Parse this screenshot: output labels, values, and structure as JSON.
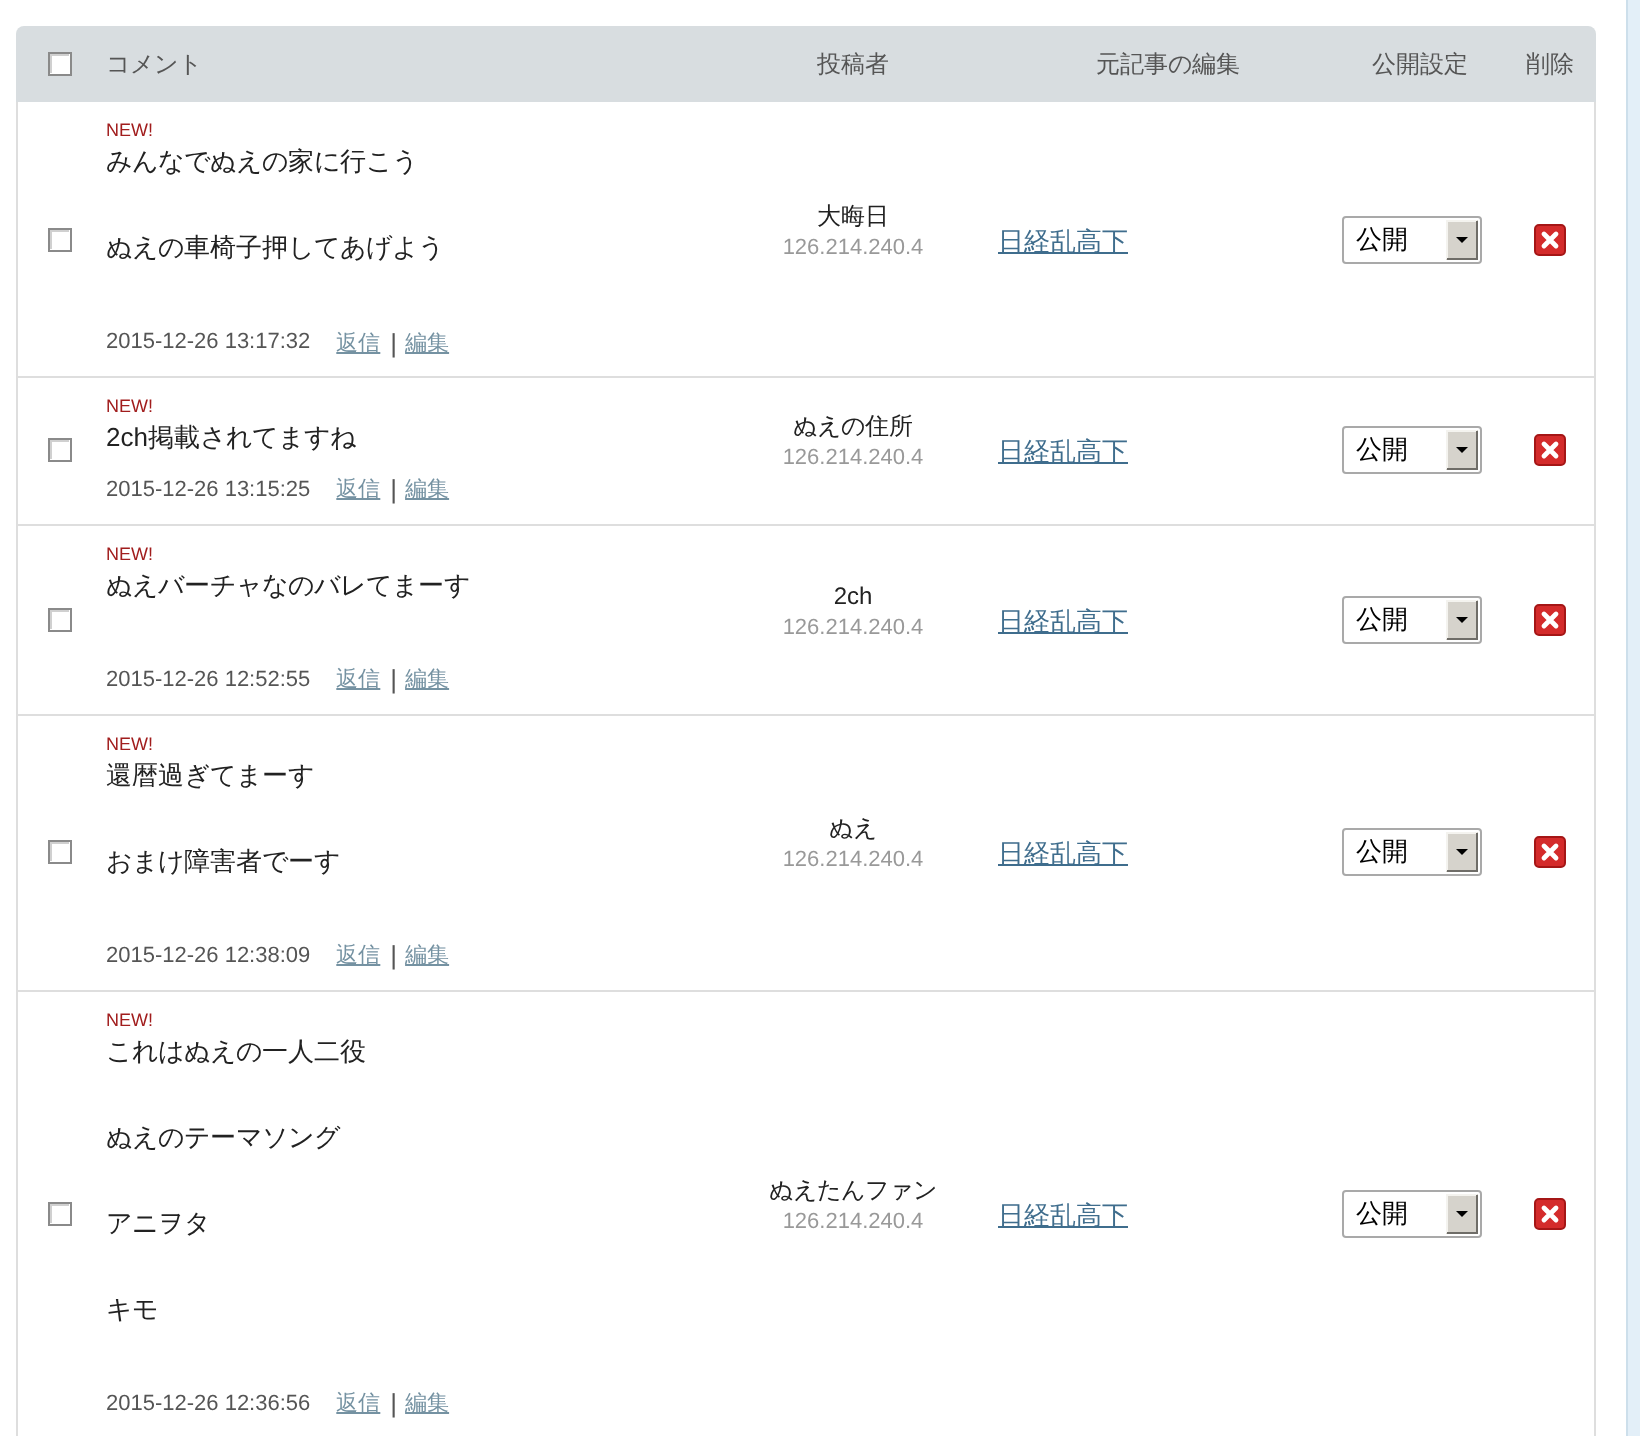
{
  "table": {
    "select_all": {
      "checked": false
    },
    "columns": [
      "コメント",
      "投稿者",
      "元記事の編集",
      "公開設定",
      "削除"
    ],
    "rows": [
      {
        "checked": false,
        "badge": "NEW!",
        "comment_lines": [
          "みんなでぬえの家に行こう",
          "ぬえの車椅子押してあげよう"
        ],
        "trailing_blank_line": true,
        "date": "2015-12-26 13:17:32",
        "reply_link": "返信",
        "separator": "|",
        "edit_link": "編集",
        "author": "大晦日",
        "ip": "126.214.240.4",
        "article_link": "日経乱高下",
        "visibility": "公開"
      },
      {
        "checked": false,
        "badge": "NEW!",
        "comment_lines": [
          "2ch掲載されてますね"
        ],
        "trailing_blank_line": false,
        "date": "2015-12-26 13:15:25",
        "reply_link": "返信",
        "separator": "|",
        "edit_link": "編集",
        "author": "ぬえの住所",
        "ip": "126.214.240.4",
        "article_link": "日経乱高下",
        "visibility": "公開"
      },
      {
        "checked": false,
        "badge": "NEW!",
        "comment_lines": [
          "ぬえバーチャなのバレてまーす"
        ],
        "trailing_blank_line": true,
        "date": "2015-12-26 12:52:55",
        "reply_link": "返信",
        "separator": "|",
        "edit_link": "編集",
        "author": "2ch",
        "ip": "126.214.240.4",
        "article_link": "日経乱高下",
        "visibility": "公開"
      },
      {
        "checked": false,
        "badge": "NEW!",
        "comment_lines": [
          "還暦過ぎてまーす",
          "おまけ障害者でーす"
        ],
        "trailing_blank_line": true,
        "date": "2015-12-26 12:38:09",
        "reply_link": "返信",
        "separator": "|",
        "edit_link": "編集",
        "author": "ぬえ",
        "ip": "126.214.240.4",
        "article_link": "日経乱高下",
        "visibility": "公開"
      },
      {
        "checked": false,
        "badge": "NEW!",
        "comment_lines": [
          "これはぬえの一人二役",
          "ぬえのテーマソング",
          "アニヲタ",
          "キモ"
        ],
        "trailing_blank_line": true,
        "date": "2015-12-26 12:36:56",
        "reply_link": "返信",
        "separator": "|",
        "edit_link": "編集",
        "author": "ぬえたんファン",
        "ip": "126.214.240.4",
        "article_link": "日経乱高下",
        "visibility": "公開"
      }
    ]
  }
}
